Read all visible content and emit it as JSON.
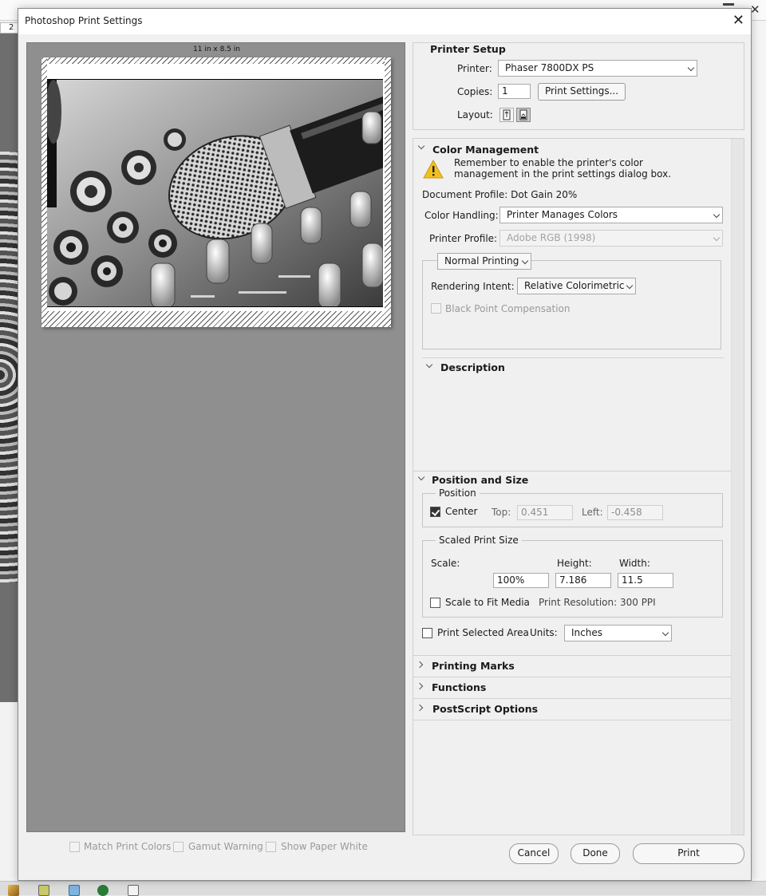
{
  "dialog": {
    "title": "Photoshop Print Settings",
    "close_glyph": "✕"
  },
  "background": {
    "ruler_mark": "2",
    "close_glyph": "✕"
  },
  "preview": {
    "paper_size": "11 in x 8.5 in"
  },
  "printer_setup": {
    "heading": "Printer Setup",
    "printer_label": "Printer:",
    "printer_value": "Phaser 7800DX PS",
    "copies_label": "Copies:",
    "copies_value": "1",
    "print_settings_button": "Print Settings...",
    "layout_label": "Layout:"
  },
  "color_management": {
    "heading": "Color Management",
    "warning_line1": "Remember to enable the printer's color",
    "warning_line2": "management in the print settings dialog box.",
    "document_profile": "Document Profile: Dot Gain 20%",
    "color_handling_label": "Color Handling:",
    "color_handling_value": "Printer Manages Colors",
    "printer_profile_label": "Printer Profile:",
    "printer_profile_value": "Adobe RGB (1998)",
    "print_mode_value": "Normal Printing",
    "rendering_intent_label": "Rendering Intent:",
    "rendering_intent_value": "Relative Colorimetric",
    "black_point_label": "Black Point Compensation"
  },
  "description": {
    "heading": "Description"
  },
  "position_size": {
    "heading": "Position and Size",
    "position_group": "Position",
    "center_label": "Center",
    "top_label": "Top:",
    "top_value": "0.451",
    "left_label": "Left:",
    "left_value": "-0.458",
    "scaled_group": "Scaled Print Size",
    "scale_label": "Scale:",
    "height_label": "Height:",
    "width_label": "Width:",
    "scale_value": "100%",
    "height_value": "7.186",
    "width_value": "11.5",
    "scale_to_fit_label": "Scale to Fit Media",
    "print_resolution": "Print Resolution: 300 PPI",
    "print_selected_label": "Print Selected Area",
    "units_label": "Units:",
    "units_value": "Inches"
  },
  "sections": {
    "printing_marks": "Printing Marks",
    "functions": "Functions",
    "postscript_options": "PostScript Options"
  },
  "bottom": {
    "match_print_colors": "Match Print Colors",
    "gamut_warning": "Gamut Warning",
    "show_paper_white": "Show Paper White",
    "cancel_button": "Cancel",
    "done_button": "Done",
    "print_button": "Print"
  }
}
